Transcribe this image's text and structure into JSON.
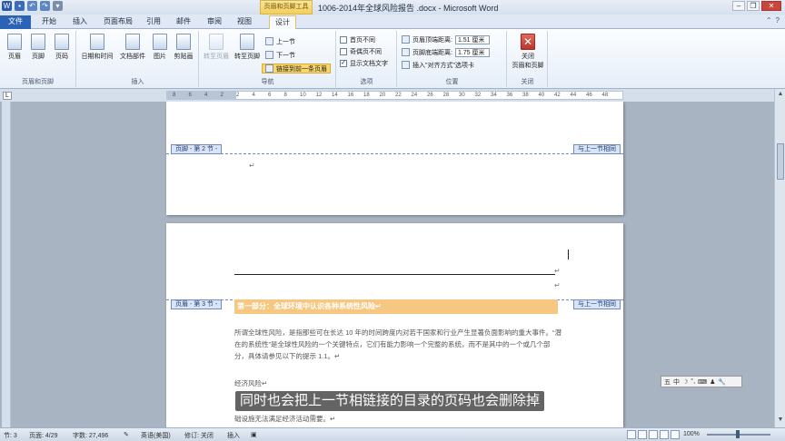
{
  "window": {
    "title": "1006-2014年全球风险报告 .docx - Microsoft Word",
    "context_tool_label": "页眉和页脚工具",
    "qat_icons": [
      "word-icon",
      "save-icon",
      "undo-icon",
      "redo-icon",
      "customize-icon"
    ]
  },
  "tabs": {
    "file": "文件",
    "home": "开始",
    "insert": "插入",
    "layout": "页面布局",
    "references": "引用",
    "mailings": "邮件",
    "review": "审阅",
    "view": "视图",
    "design": "设计"
  },
  "ribbon": {
    "group_header_footer": {
      "label": "页眉和页脚",
      "header": "页眉",
      "footer": "页脚",
      "page_number": "页码"
    },
    "group_insert": {
      "label": "插入",
      "datetime": "日期和时间",
      "quickparts": "文档部件",
      "picture": "图片",
      "clipart": "剪贴画"
    },
    "group_nav": {
      "label": "导航",
      "goto_header": "转至页眉",
      "goto_footer": "转至页脚",
      "prev": "上一节",
      "next": "下一节",
      "link_prev": "链接到前一条页眉"
    },
    "group_options": {
      "label": "选项",
      "first_diff": "首页不同",
      "odd_even_diff": "奇偶页不同",
      "show_doc_text": "显示文档文字"
    },
    "group_position": {
      "label": "位置",
      "header_from_top": "页眉顶端距离:",
      "header_from_top_value": "1.51 厘米",
      "footer_from_bottom": "页脚底端距离:",
      "footer_from_bottom_value": "1.75 厘米",
      "insert_align_tab": "插入\"对齐方式\"选项卡"
    },
    "group_close": {
      "label": "关闭",
      "close_button": "关闭\n页眉和页脚"
    }
  },
  "ruler": {
    "ticks": [
      "8",
      "6",
      "4",
      "2",
      "2",
      "4",
      "6",
      "8",
      "10",
      "12",
      "14",
      "16",
      "18",
      "20",
      "22",
      "24",
      "26",
      "28",
      "30",
      "32",
      "34",
      "36",
      "38",
      "40",
      "42",
      "44",
      "46",
      "48"
    ]
  },
  "document": {
    "page1_footer_tag": "页脚 - 第 2 节 -",
    "page1_same_as_prev": "与上一节相同",
    "page2_header_tag": "页眉 - 第 3 节 -",
    "page2_same_as_prev": "与上一节相同",
    "para_mark": "↵",
    "heading": "第一部分：全球环境中认识各种系统性风险↵",
    "body_para1": "所谓全球性风险，是指那些可在长达 10 年的时间跨度内对若干国家和行业产生显著负面影响的重大事件。“潜在的系统性”是全球性风险的一个关键特点，它们有能力影响一个完整的系统，而不是其中的一个或几个部分，具体请参见以下的提示 1.1。↵",
    "body_econ": "经济风险↵",
    "body_line3": "础设施无法满足经济活动需要。↵"
  },
  "ime": {
    "items": [
      "五",
      "中",
      "☽",
      "°,",
      "⌨",
      "♟",
      "🔧"
    ]
  },
  "subtitle": "同时也会把上一节相链接的目录的页码也会删除掉",
  "status": {
    "section": "节: 3",
    "page": "页面: 4/29",
    "words": "字数: 27,496",
    "lang": "英语(美国)",
    "track": "修订: 关闭",
    "mode": "插入",
    "zoom": "100%"
  }
}
